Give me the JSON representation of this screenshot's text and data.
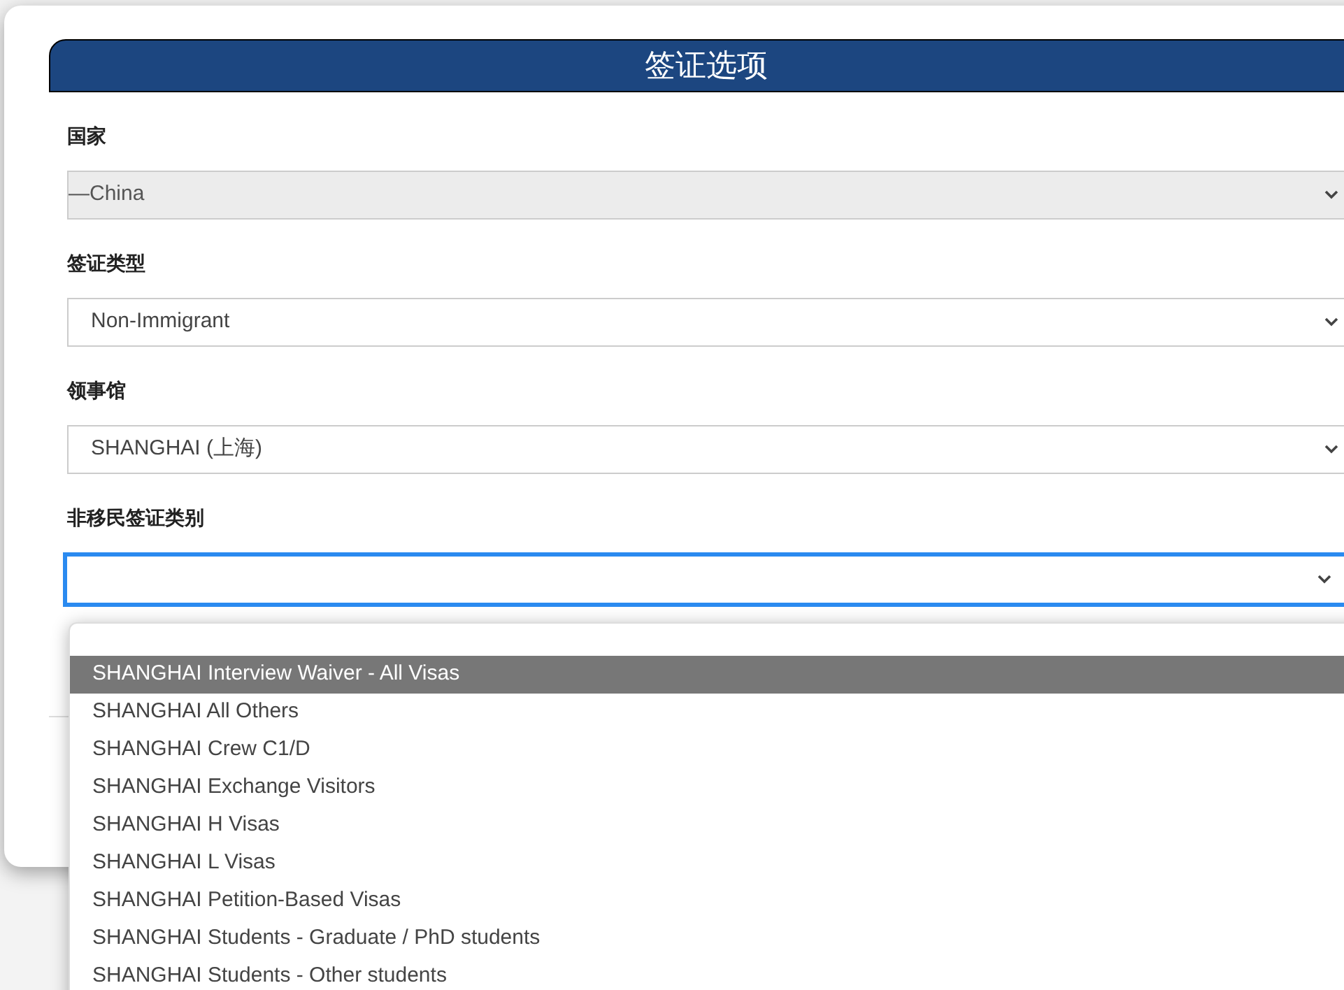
{
  "header": {
    "title": "签证选项"
  },
  "fields": [
    {
      "label": "国家",
      "value": "—China",
      "disabled": true,
      "focused": false
    },
    {
      "label": "签证类型",
      "value": "Non-Immigrant",
      "disabled": false,
      "focused": false
    },
    {
      "label": "领事馆",
      "value": "SHANGHAI (上海)",
      "disabled": false,
      "focused": false
    },
    {
      "label": "非移民签证类别",
      "disabled": false,
      "focused": true
    }
  ],
  "dropdown_options": [
    {
      "label": "SHANGHAI Interview Waiver - All Visas",
      "selected": true
    },
    {
      "label": "SHANGHAI All Others",
      "selected": false
    },
    {
      "label": "SHANGHAI Crew C1/D",
      "selected": false
    },
    {
      "label": "SHANGHAI Exchange Visitors",
      "selected": false
    },
    {
      "label": "SHANGHAI H Visas",
      "selected": false
    },
    {
      "label": "SHANGHAI L Visas",
      "selected": false
    },
    {
      "label": "SHANGHAI Petition-Based Visas",
      "selected": false
    },
    {
      "label": "SHANGHAI Students - Graduate / PhD students",
      "selected": false
    },
    {
      "label": "SHANGHAI Students - Other students",
      "selected": false
    }
  ]
}
